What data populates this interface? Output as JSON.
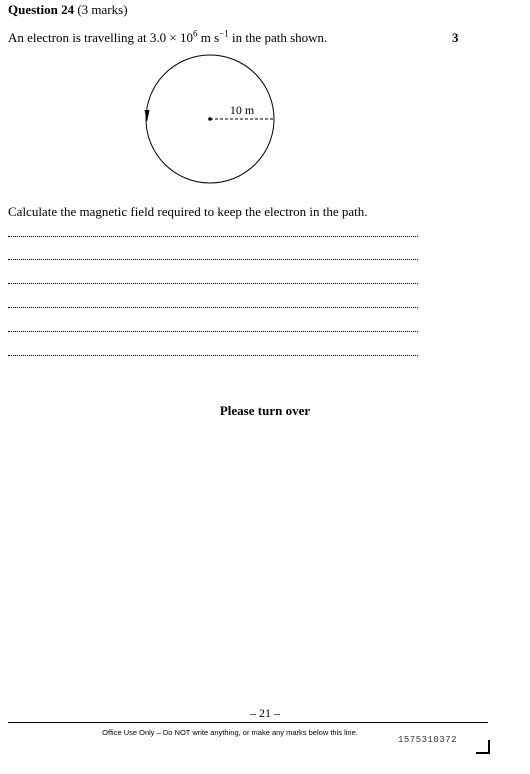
{
  "question": {
    "number_label": "Question 24",
    "marks_label": "(3 marks)",
    "intro_prefix": "An electron is travelling at 3.0 × 10",
    "intro_exponent": "6",
    "intro_unit": " m s",
    "intro_unit_exponent": "−1",
    "intro_suffix": " in the path shown.",
    "marks_value": "3",
    "diagram": {
      "radius_label": "10 m"
    },
    "instruction": "Calculate the magnetic field required to keep the electron in the path.",
    "answer_lines": 6
  },
  "footer": {
    "turn_over": "Please turn over",
    "page_number": "– 21 –",
    "office_use": "Office Use Only – Do NOT write anything, or make any marks below this line.",
    "barcode_number": "1575310372"
  }
}
